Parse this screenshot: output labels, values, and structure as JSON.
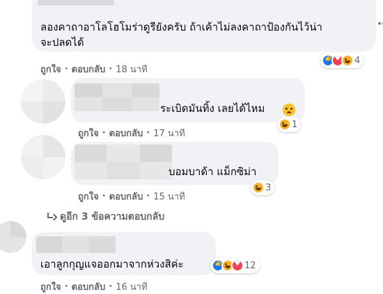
{
  "colors": {
    "bubble": "#f0f2f5",
    "meta_text": "#65676b",
    "like": "#1877f2",
    "love": "#f33e58",
    "haha": "#f7b125"
  },
  "comments": [
    {
      "text_line1": "ลองคาถาอาโลโฮโมร่าดูรียังครับ ถ้าเค้าไม่ลงคาถาป้องกันไว้น่า",
      "text_line2": "จะปลดได้",
      "like_label": "ถูกใจ",
      "reply_label": "ตอบกลับ",
      "time": "18 นาที",
      "reactions": [
        "like-icon",
        "love-icon",
        "haha-icon"
      ],
      "reaction_count": "4"
    },
    {
      "text": "ระเบิดมันทิ้ง เลยได้ไหม",
      "like_label": "ถูกใจ",
      "reply_label": "ตอบกลับ",
      "time": "17 นาที",
      "reactions": [
        "haha-icon"
      ],
      "reaction_count": "1"
    },
    {
      "text": "บอมบาด้า แม็กซิม่า",
      "like_label": "ถูกใจ",
      "reply_label": "ตอบกลับ",
      "time": "15 นาที",
      "reactions": [
        "haha-icon"
      ],
      "reaction_count": "3"
    },
    {
      "text": "เอาลูกกุญแจออกมาจากห่วงสิค่ะ",
      "like_label": "ถูกใจ",
      "reply_label": "ตอบกลับ",
      "time": "16 นาที",
      "reactions": [
        "like-icon",
        "haha-icon",
        "love-icon"
      ],
      "reaction_count": "12"
    }
  ],
  "view_more_replies": "ดูอีก 3 ข้อความตอบกลับ"
}
